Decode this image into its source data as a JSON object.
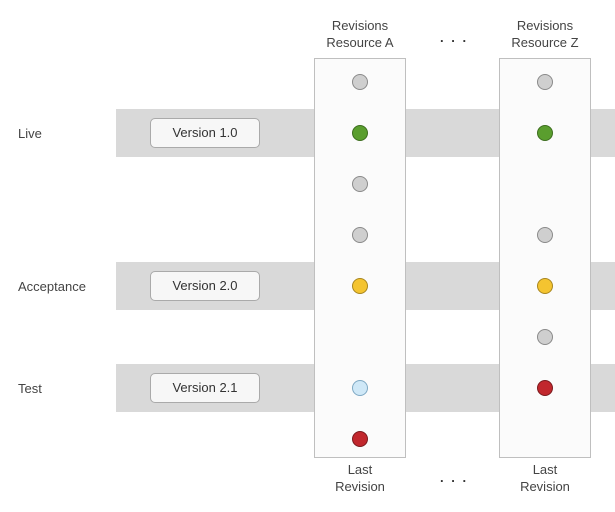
{
  "columns": {
    "a": {
      "header_line1": "Revisions",
      "header_line2": "Resource A"
    },
    "z": {
      "header_line1": "Revisions",
      "header_line2": "Resource Z"
    },
    "ellipsis_top": ". . .",
    "ellipsis_bottom": ". . ."
  },
  "environments": {
    "live": {
      "label": "Live",
      "version": "Version 1.0"
    },
    "acceptance": {
      "label": "Acceptance",
      "version": "Version 2.0"
    },
    "test": {
      "label": "Test",
      "version": "Version 2.1"
    }
  },
  "resource_a": {
    "dots": [
      {
        "color": "gray"
      },
      {
        "color": "green"
      },
      {
        "color": "gray"
      },
      {
        "color": "gray"
      },
      {
        "color": "amber"
      },
      {
        "color": "blue"
      },
      {
        "color": "red"
      }
    ],
    "footer_line1": "Last",
    "footer_line2": "Revision"
  },
  "resource_z": {
    "dots": [
      {
        "color": "gray"
      },
      {
        "color": "green"
      },
      {
        "color": "gray"
      },
      {
        "color": "amber"
      },
      {
        "color": "gray"
      },
      {
        "color": "red"
      }
    ],
    "footer_line1": "Last",
    "footer_line2": "Revision"
  },
  "chart_data": {
    "type": "table",
    "environments": [
      "Live",
      "Acceptance",
      "Test"
    ],
    "versions": [
      "Version 1.0",
      "Version 2.0",
      "Version 2.1"
    ],
    "resources": [
      "Resource A",
      "Resource Z"
    ],
    "resource_a_revisions": [
      {
        "position": 1,
        "status": "gray",
        "environment": null
      },
      {
        "position": 2,
        "status": "green",
        "environment": "Live"
      },
      {
        "position": 3,
        "status": "gray",
        "environment": null
      },
      {
        "position": 4,
        "status": "gray",
        "environment": null
      },
      {
        "position": 5,
        "status": "amber",
        "environment": "Acceptance"
      },
      {
        "position": 6,
        "status": "blue",
        "environment": "Test"
      },
      {
        "position": 7,
        "status": "red",
        "environment": null,
        "is_last": true
      }
    ],
    "resource_z_revisions": [
      {
        "position": 1,
        "status": "gray",
        "environment": null
      },
      {
        "position": 2,
        "status": "green",
        "environment": "Live"
      },
      {
        "position": 3,
        "status": "gray",
        "environment": null
      },
      {
        "position": 4,
        "status": "amber",
        "environment": "Acceptance"
      },
      {
        "position": 5,
        "status": "gray",
        "environment": null
      },
      {
        "position": 6,
        "status": "red",
        "environment": "Test",
        "is_last": true
      }
    ],
    "footer_label": "Last Revision"
  }
}
